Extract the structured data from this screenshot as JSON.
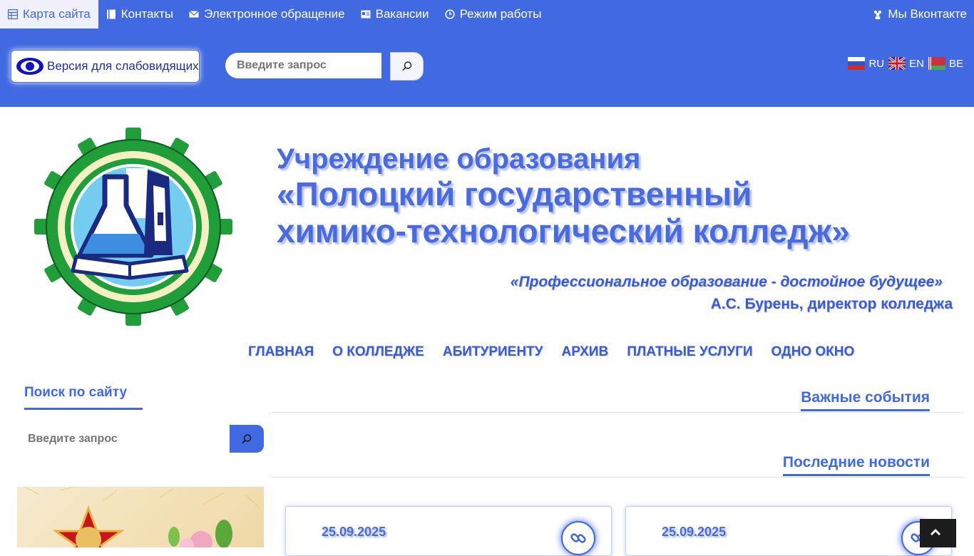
{
  "topnav": {
    "items": [
      {
        "label": "Карта сайта",
        "icon": "sitemap-icon",
        "active": true
      },
      {
        "label": "Контакты",
        "icon": "book-icon"
      },
      {
        "label": "Электронное обращение",
        "icon": "envelope-icon"
      },
      {
        "label": "Вакансии",
        "icon": "id-card-icon"
      },
      {
        "label": "Режим работы",
        "icon": "clock-icon"
      }
    ],
    "vk_label": "Мы Вконтакте"
  },
  "accessibility": {
    "label": "Версия для слабовидящих"
  },
  "search_top": {
    "placeholder": "Введите запрос"
  },
  "languages": [
    {
      "code": "RU"
    },
    {
      "code": "EN"
    },
    {
      "code": "BE"
    }
  ],
  "header": {
    "line1": "Учреждение образования",
    "line2": "«Полоцкий государственный",
    "line3": "химико-технологический колледж»",
    "motto": "«Профессиональное образование - достойное будущее»",
    "motto_author": "А.С. Бурень, директор колледжа"
  },
  "mainnav": [
    "ГЛАВНАЯ",
    "О КОЛЛЕДЖЕ",
    "АБИТУРИЕНТУ",
    "АРХИВ",
    "ПЛАТНЫЕ УСЛУГИ",
    "ОДНО ОКНО"
  ],
  "sidebar": {
    "title": "Поиск по сайту",
    "search_placeholder": "Введите запрос"
  },
  "sections": {
    "important": "Важные события",
    "news": "Последние новости"
  },
  "news_cards": [
    {
      "date": "25.09.2025"
    },
    {
      "date": "25.09.2025"
    }
  ],
  "colors": {
    "brand": "#4169e1",
    "title": "#4a6ae0",
    "logo_green": "#1f9e3a",
    "logo_navy": "#1a2a80"
  }
}
